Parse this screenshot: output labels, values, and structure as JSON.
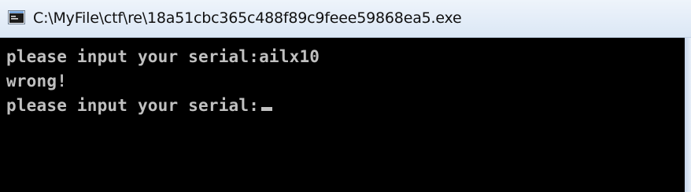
{
  "window": {
    "title": "C:\\MyFile\\ctf\\re\\18a51cbc365c488f89c9feee59868ea5.exe",
    "icon": "console-window-icon"
  },
  "console": {
    "lines": [
      "please input your serial:ailx10",
      "wrong!",
      "please input your serial:"
    ],
    "colors": {
      "background": "#000000",
      "text": "#c0c0c0"
    }
  }
}
